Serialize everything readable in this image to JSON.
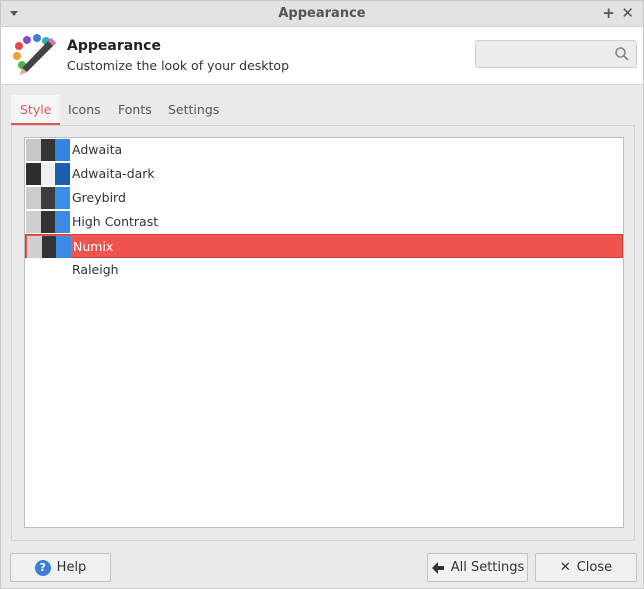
{
  "window": {
    "title": "Appearance"
  },
  "header": {
    "title": "Appearance",
    "subtitle": "Customize the look of your desktop",
    "search_placeholder": ""
  },
  "tabs": [
    {
      "label": "Style",
      "active": true
    },
    {
      "label": "Icons",
      "active": false
    },
    {
      "label": "Fonts",
      "active": false
    },
    {
      "label": "Settings",
      "active": false
    }
  ],
  "themes": [
    {
      "name": "Adwaita",
      "colors": [
        "#c8c8c8",
        "#353535",
        "#3584e4"
      ],
      "selected": false
    },
    {
      "name": "Adwaita-dark",
      "colors": [
        "#2d2d2d",
        "#f0f0f0",
        "#1a5fb4"
      ],
      "selected": false
    },
    {
      "name": "Greybird",
      "colors": [
        "#cccccc",
        "#3c3c3c",
        "#398ee7"
      ],
      "selected": false
    },
    {
      "name": "High Contrast",
      "colors": [
        "#cfcfcf",
        "#333333",
        "#3d8ae6"
      ],
      "selected": false
    },
    {
      "name": "Numix",
      "colors": [
        "#cfcfcf",
        "#333333",
        "#3d8ae6"
      ],
      "selected": true
    },
    {
      "name": "Raleigh",
      "colors": [],
      "selected": false
    }
  ],
  "footer": {
    "help_label": "Help",
    "all_settings_label": "All Settings",
    "close_label": "Close"
  },
  "colors": {
    "accent": "#e25555",
    "selection": "#f0544f"
  }
}
